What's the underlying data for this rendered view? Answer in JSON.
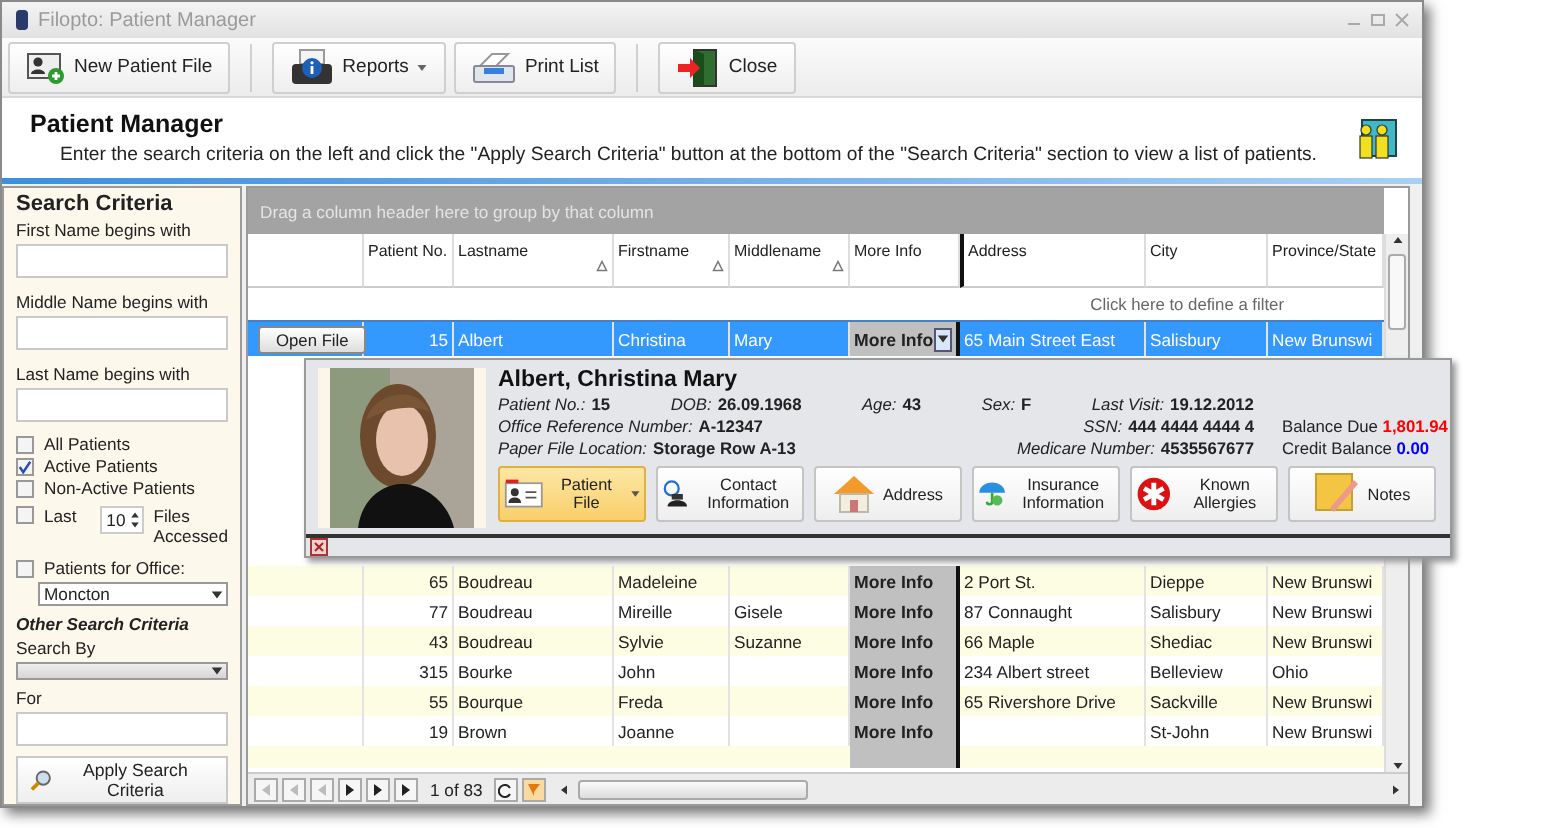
{
  "window": {
    "title": "Filopto: Patient Manager"
  },
  "toolbar": [
    {
      "kind": "new_patient",
      "label": "New Patient File",
      "dropdown": false
    },
    {
      "kind": "reports",
      "label": "Reports",
      "dropdown": true
    },
    {
      "kind": "print",
      "label": "Print List",
      "dropdown": false
    },
    {
      "kind": "close",
      "label": "Close",
      "dropdown": false
    }
  ],
  "header": {
    "title": "Patient Manager",
    "description": "Enter the search criteria on the left and click the \"Apply Search Criteria\" button at the bottom of the \"Search Criteria\" section to view a list of patients."
  },
  "search": {
    "title": "Search Criteria",
    "fields": [
      {
        "label": "First Name begins with"
      },
      {
        "label": "Middle Name begins with"
      },
      {
        "label": "Last Name begins with"
      }
    ],
    "options": [
      {
        "label": "All Patients",
        "checked": false
      },
      {
        "label": "Active Patients",
        "checked": true
      },
      {
        "label": "Non-Active Patients",
        "checked": false
      }
    ],
    "last": {
      "checked": false,
      "label": "Last",
      "count": "10",
      "suffix": "Files Accessed"
    },
    "office": {
      "checked": false,
      "label": "Patients for Office:",
      "value": "Moncton"
    },
    "other_title": "Other Search Criteria",
    "search_by_label": "Search By",
    "for_label": "For",
    "apply": "Apply Search Criteria"
  },
  "grid": {
    "group_hint": "Drag a column header here to group by that column",
    "columns": [
      {
        "sortable": false
      },
      {
        "label": "Patient No.",
        "sortable": false
      },
      {
        "label": "Lastname",
        "sortable": true
      },
      {
        "label": "Firstname",
        "sortable": true
      },
      {
        "label": "Middlename",
        "sortable": true
      },
      {
        "label": "More Info",
        "sortable": false
      },
      {
        "label": "Address",
        "sortable": false
      },
      {
        "label": "City",
        "sortable": false
      },
      {
        "label": "Province/State",
        "sortable": false
      }
    ],
    "filter_hint": "Click here to define a filter",
    "open_button": "Open File",
    "rows": [
      {
        "patient_no": "15",
        "lastname": "Albert",
        "firstname": "Christina",
        "middlename": "Mary",
        "more_info": "More Info",
        "address": "65 Main Street East",
        "city": "Salisbury",
        "province": "New Brunswi",
        "selected": true
      },
      {
        "patient_no": "65",
        "lastname": "Boudreau",
        "firstname": "Madeleine",
        "middlename": "",
        "more_info": "More Info",
        "address": "2 Port St.",
        "city": "Dieppe",
        "province": "New Brunswi",
        "selected": false
      },
      {
        "patient_no": "77",
        "lastname": "Boudreau",
        "firstname": "Mireille",
        "middlename": "Gisele",
        "more_info": "More Info",
        "address": "87 Connaught",
        "city": "Salisbury",
        "province": "New Brunswi",
        "selected": false
      },
      {
        "patient_no": "43",
        "lastname": "Boudreau",
        "firstname": "Sylvie",
        "middlename": "Suzanne",
        "more_info": "More Info",
        "address": "66 Maple",
        "city": "Shediac",
        "province": "New Brunswi",
        "selected": false
      },
      {
        "patient_no": "315",
        "lastname": "Bourke",
        "firstname": "John",
        "middlename": "",
        "more_info": "More Info",
        "address": "234 Albert street",
        "city": "Belleview",
        "province": "Ohio",
        "selected": false
      },
      {
        "patient_no": "55",
        "lastname": "Bourque",
        "firstname": "Freda",
        "middlename": "",
        "more_info": "More Info",
        "address": "65 Rivershore Drive",
        "city": "Sackville",
        "province": "New Brunswi",
        "selected": false
      },
      {
        "patient_no": "19",
        "lastname": "Brown",
        "firstname": "Joanne",
        "middlename": "",
        "more_info": "More Info",
        "address": "",
        "city": "St-John",
        "province": "New Brunswi",
        "selected": false
      }
    ],
    "pager": "1 of 83"
  },
  "detail": {
    "name": "Albert, Christina Mary",
    "lines": [
      [
        {
          "label": "Patient No.:",
          "value": "15"
        },
        {
          "label": "DOB:",
          "value": "26.09.1968"
        },
        {
          "label": "Age:",
          "value": "43"
        },
        {
          "label": "Sex:",
          "value": "F"
        },
        {
          "label": "Last Visit:",
          "value": "19.12.2012"
        }
      ],
      [
        {
          "label": "Office Reference Number:",
          "value": "A-12347"
        },
        {
          "label": "SSN:",
          "value": "444 4444 4444 4"
        }
      ],
      [
        {
          "label": "Paper File Location:",
          "value": "Storage Row A-13"
        },
        {
          "label": "Medicare Number:",
          "value": "4535567677"
        }
      ]
    ],
    "balances": [
      {
        "label": "Balance Due",
        "value": "1,801.94",
        "color": "#ff0000"
      },
      {
        "label": "Credit Balance",
        "value": "0.00",
        "color": "#0000ff"
      }
    ],
    "actions": [
      {
        "kind": "patient_file",
        "label": "Patient File",
        "selected": true
      },
      {
        "kind": "contact",
        "label": "Contact Information",
        "selected": false
      },
      {
        "kind": "address",
        "label": "Address",
        "selected": false
      },
      {
        "kind": "insurance",
        "label": "Insurance Information",
        "selected": false
      },
      {
        "kind": "allergies",
        "label": "Known Allergies",
        "selected": false
      },
      {
        "kind": "notes",
        "label": "Notes",
        "selected": false
      }
    ]
  }
}
